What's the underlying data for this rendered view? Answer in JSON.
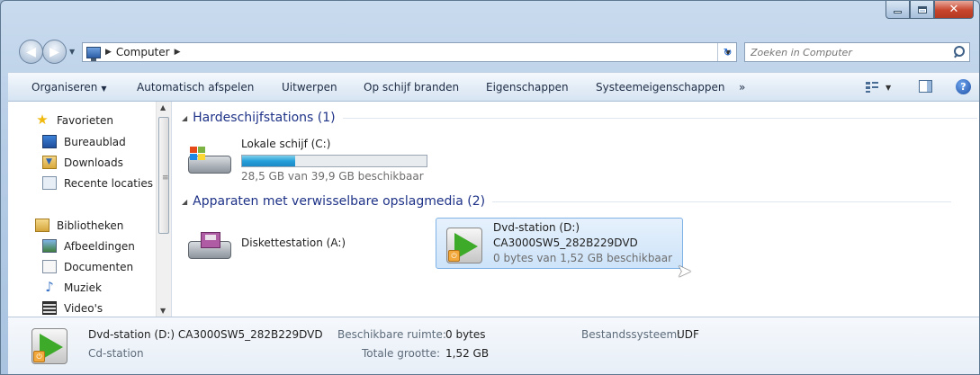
{
  "address_bar": {
    "crumbs": [
      "Computer"
    ],
    "search_placeholder": "Zoeken in Computer"
  },
  "toolbar": {
    "organize": "Organiseren",
    "autoplay": "Automatisch afspelen",
    "eject": "Uitwerpen",
    "burn": "Op schijf branden",
    "properties": "Eigenschappen",
    "system_properties": "Systeemeigenschappen",
    "more": "»"
  },
  "sidebar": {
    "favorites_header": "Favorieten",
    "favorites": [
      "Bureaublad",
      "Downloads",
      "Recente locaties"
    ],
    "libraries_header": "Bibliotheken",
    "libraries": [
      "Afbeeldingen",
      "Documenten",
      "Muziek",
      "Video's"
    ]
  },
  "groups": {
    "hard_drives": "Hardeschijfstations (1)",
    "removable": "Apparaten met verwisselbare opslagmedia (2)"
  },
  "drives": {
    "c": {
      "name": "Lokale schijf (C:)",
      "free_text": "28,5 GB van 39,9 GB beschikbaar",
      "used_fraction": 0.286
    },
    "a": {
      "name": "Diskettestation (A:)"
    },
    "d": {
      "name": "Dvd-station (D:)",
      "label": "CA3000SW5_282B229DVD",
      "free_text": "0 bytes van 1,52 GB beschikbaar"
    }
  },
  "details": {
    "title": "Dvd-station (D:) CA3000SW5_282B229DVD",
    "type": "Cd-station",
    "free_label": "Beschikbare ruimte:",
    "free_value": "0 bytes",
    "total_label": "Totale grootte:",
    "total_value": "1,52 GB",
    "fs_label": "Bestandssysteem:",
    "fs_value": "UDF"
  },
  "colors": {
    "group_header": "#1e3287",
    "selection": "#cde3f9",
    "bar_fill": "#26a0da"
  }
}
